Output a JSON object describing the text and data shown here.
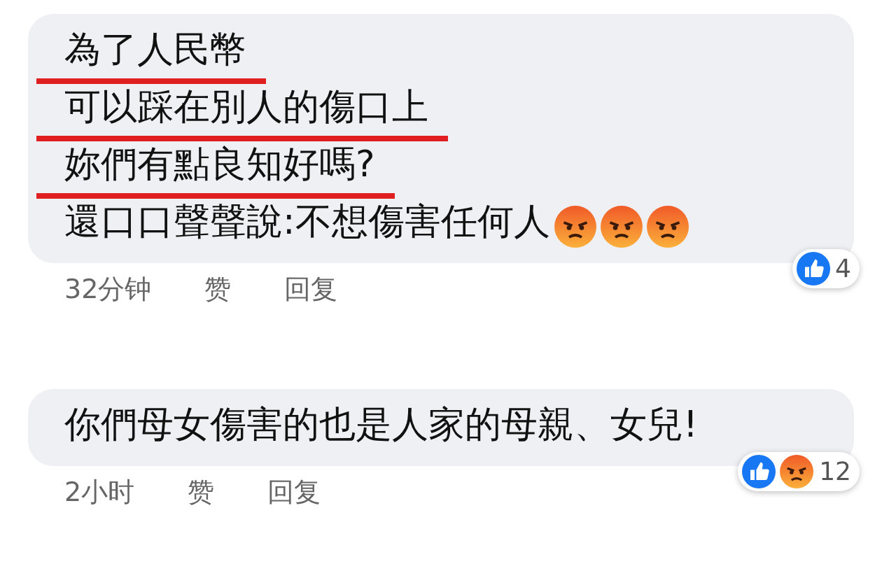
{
  "comments": [
    {
      "lines": [
        {
          "text": "為了人民幣",
          "underlined": true
        },
        {
          "text": "可以踩在別人的傷口上",
          "underlined": true
        },
        {
          "text": "妳們有點良知好嗎?",
          "underlined": true
        },
        {
          "text": "還口口聲聲說:不想傷害任何人",
          "underlined": false,
          "icons": [
            {
              "kind": "angry"
            },
            {
              "kind": "angry"
            },
            {
              "kind": "angry"
            }
          ]
        }
      ],
      "time": "32分钟",
      "like": "赞",
      "reply": "回复",
      "reactions": [
        {
          "kind": "like"
        }
      ],
      "reaction_count": "4"
    },
    {
      "lines": [
        {
          "text": "你們母女傷害的也是人家的母親、女兒!",
          "underlined": false
        }
      ],
      "time": "2小时",
      "like": "赞",
      "reply": "回复",
      "reactions": [
        {
          "kind": "like"
        },
        {
          "kind": "angry"
        }
      ],
      "reaction_count": "12"
    }
  ]
}
